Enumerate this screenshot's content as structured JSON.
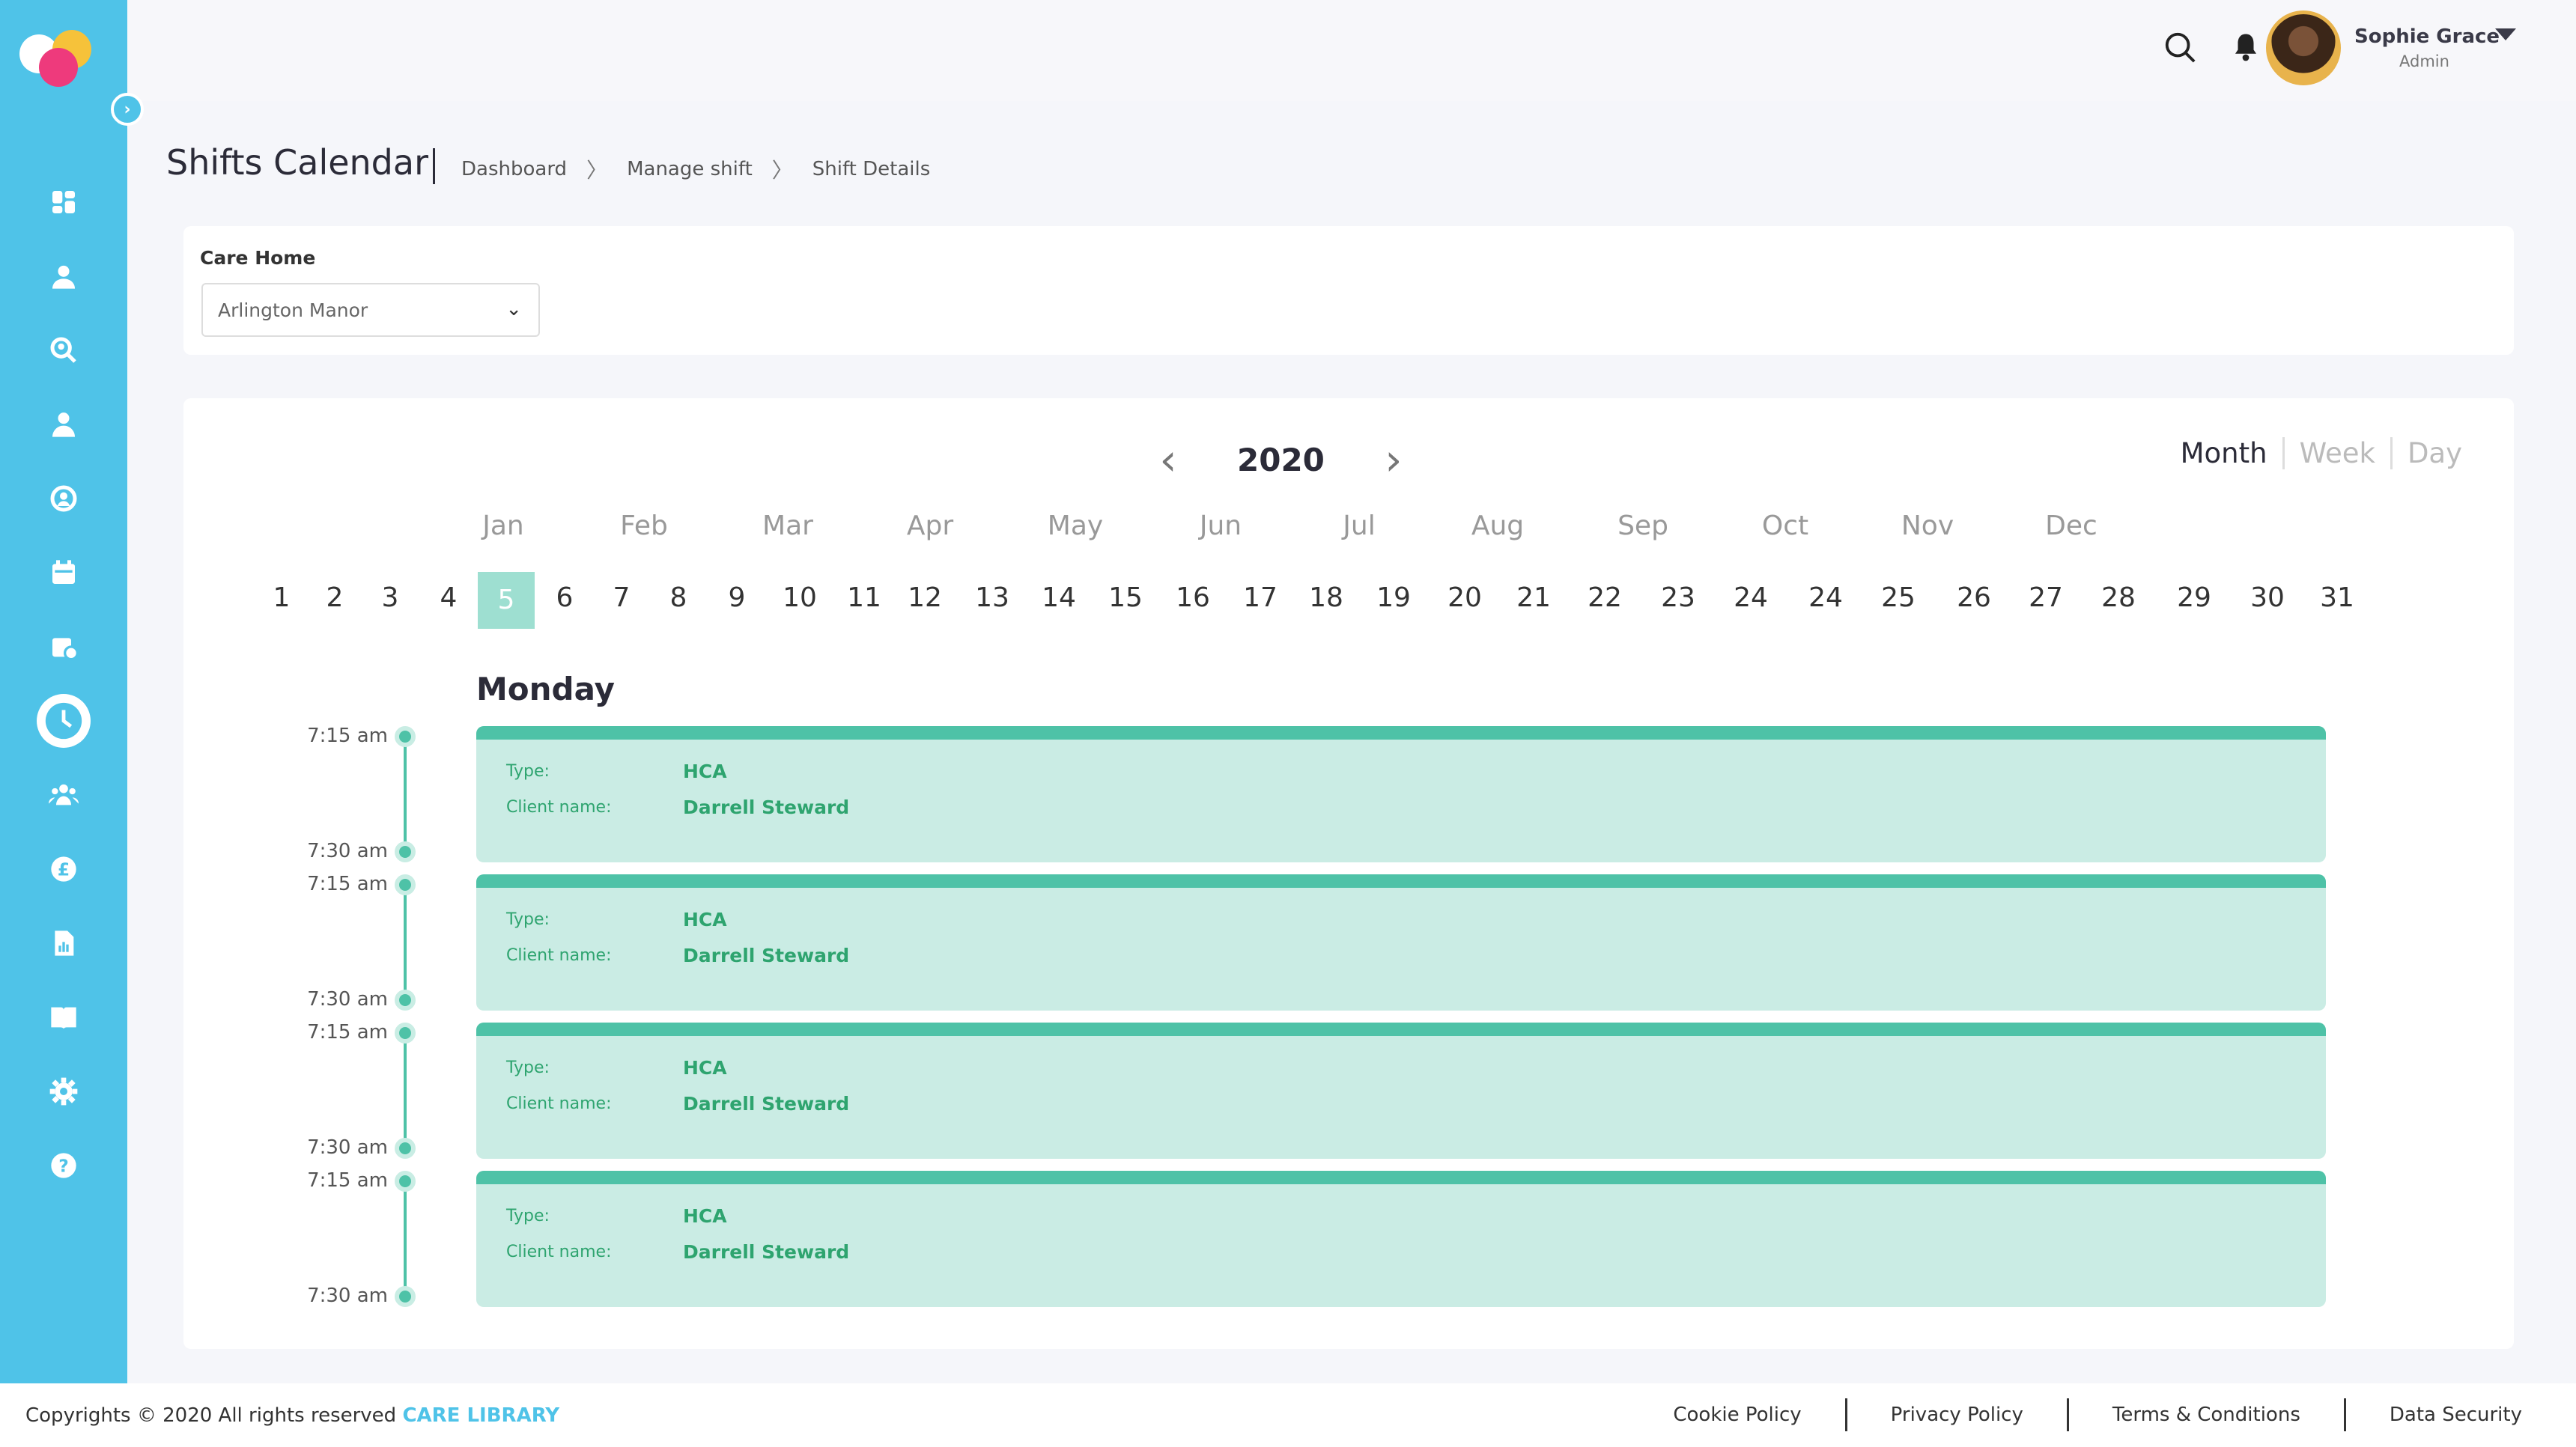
{
  "header": {
    "user": {
      "name": "Sophie Grace",
      "role": "Admin"
    }
  },
  "page": {
    "title": "Shifts Calendar",
    "breadcrumbs": [
      "Dashboard",
      "Manage shift",
      "Shift Details"
    ]
  },
  "filter": {
    "label": "Care Home",
    "selected": "Arlington Manor"
  },
  "calendar": {
    "year": "2020",
    "views": [
      "Month",
      "Week",
      "Day"
    ],
    "active_view": "Month",
    "months": [
      "Jan",
      "Feb",
      "Mar",
      "Apr",
      "May",
      "Jun",
      "Jul",
      "Aug",
      "Sep",
      "Oct",
      "Nov",
      "Dec"
    ],
    "days": [
      "1",
      "2",
      "3",
      "4",
      "5",
      "6",
      "7",
      "8",
      "9",
      "10",
      "11",
      "12",
      "13",
      "14",
      "15",
      "16",
      "17",
      "18",
      "19",
      "20",
      "21",
      "22",
      "23",
      "24",
      "24",
      "25",
      "26",
      "27",
      "28",
      "29",
      "30",
      "31"
    ],
    "selected_day": "5",
    "day_of_week": "Monday"
  },
  "shifts": [
    {
      "start": "7:15 am",
      "end": "7:30 am",
      "type_label": "Type:",
      "type": "HCA",
      "client_label": "Client name:",
      "client": "Darrell Steward"
    },
    {
      "start": "7:15 am",
      "end": "7:30 am",
      "type_label": "Type:",
      "type": "HCA",
      "client_label": "Client name:",
      "client": "Darrell Steward"
    },
    {
      "start": "7:15 am",
      "end": "7:30 am",
      "type_label": "Type:",
      "type": "HCA",
      "client_label": "Client name:",
      "client": "Darrell Steward"
    },
    {
      "start": "7:15 am",
      "end": "7:30 am",
      "type_label": "Type:",
      "type": "HCA",
      "client_label": "Client name:",
      "client": "Darrell Steward"
    }
  ],
  "sidebar": {
    "icons": [
      "dashboard-icon",
      "user-icon",
      "search-user-icon",
      "staff-icon",
      "settings-user-icon",
      "calendar-icon",
      "schedule-icon",
      "clock-icon",
      "team-icon",
      "pound-icon",
      "report-icon",
      "book-icon",
      "gear-icon",
      "help-icon"
    ],
    "active": "clock-icon"
  },
  "footer": {
    "copyright": "Copyrights © 2020  All rights reserved",
    "brand": "CARE LIBRARY",
    "links": [
      "Cookie Policy",
      "Privacy Policy",
      "Terms & Conditions",
      "Data Security"
    ]
  },
  "colors": {
    "sidebar": "#4fc3e8",
    "accent": "#4ec2a7",
    "shift_bg": "#caece4",
    "text_green": "#2ea46f"
  }
}
